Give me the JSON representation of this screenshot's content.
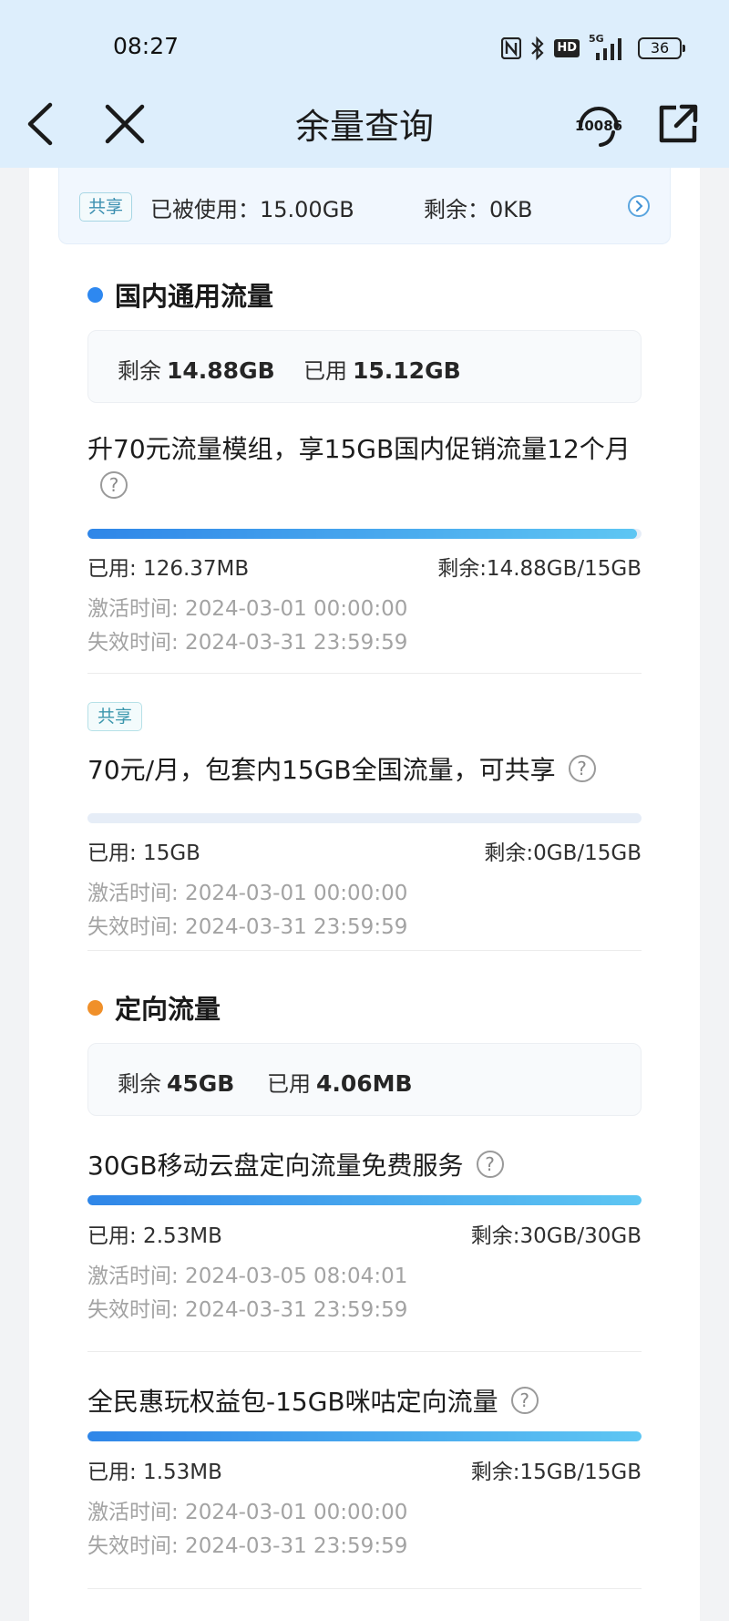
{
  "status_bar": {
    "time": "08:27",
    "network": "5G",
    "hd": "HD",
    "battery": "36"
  },
  "nav": {
    "title": "余量查询",
    "service_number": "10086"
  },
  "share_bar": {
    "tag": "共享",
    "used": "已被使用：15.00GB",
    "remain": "剩余：0KB"
  },
  "colors": {
    "domestic_dot": "#2e88f0",
    "targeted_dot": "#f0902a",
    "progress_start": "#2f86e8",
    "progress_end": "#5ec6f3"
  },
  "domestic": {
    "title": "国内通用流量",
    "summary": {
      "remain_label": "剩余",
      "remain_value": "14.88GB",
      "used_label": "已用",
      "used_value": "15.12GB"
    },
    "packages": [
      {
        "title": "升70元流量模组，享15GB国内促销流量12个月",
        "used": "已用: 126.37MB",
        "remain": "剩余:14.88GB/15GB",
        "remaining_fraction": 0.992,
        "activated": "激活时间: 2024-03-01 00:00:00",
        "expires": "失效时间: 2024-03-31 23:59:59"
      },
      {
        "tag": "共享",
        "title": "70元/月，包套内15GB全国流量，可共享",
        "used": "已用: 15GB",
        "remain": "剩余:0GB/15GB",
        "remaining_fraction": 0,
        "activated": "激活时间: 2024-03-01 00:00:00",
        "expires": "失效时间: 2024-03-31 23:59:59"
      }
    ]
  },
  "targeted": {
    "title": "定向流量",
    "summary": {
      "remain_label": "剩余",
      "remain_value": "45GB",
      "used_label": "已用",
      "used_value": "4.06MB"
    },
    "packages": [
      {
        "title": "30GB移动云盘定向流量免费服务",
        "used": "已用: 2.53MB",
        "remain": "剩余:30GB/30GB",
        "remaining_fraction": 1,
        "activated": "激活时间: 2024-03-05 08:04:01",
        "expires": "失效时间: 2024-03-31 23:59:59"
      },
      {
        "title": "全民惠玩权益包-15GB咪咕定向流量",
        "used": "已用: 1.53MB",
        "remain": "剩余:15GB/15GB",
        "remaining_fraction": 1,
        "activated": "激活时间: 2024-03-01 00:00:00",
        "expires": "失效时间: 2024-03-31 23:59:59"
      }
    ]
  }
}
